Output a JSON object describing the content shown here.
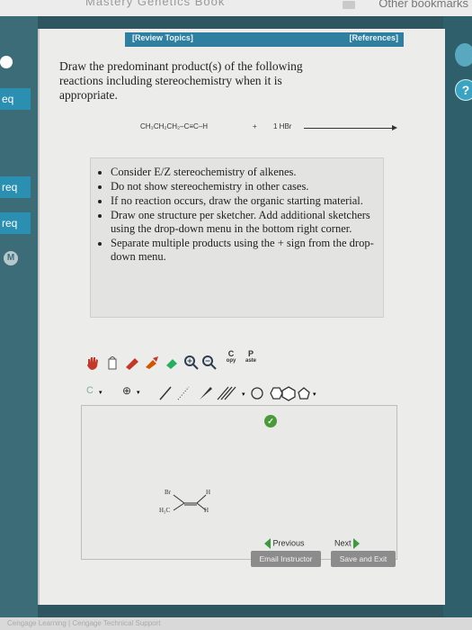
{
  "browser": {
    "ghost_text": "Mastery  Genetics Book",
    "bookmarks_label": "Other bookmarks"
  },
  "sidebar": {
    "items": [
      {
        "label": "eq"
      },
      {
        "label": "req"
      },
      {
        "label": "req"
      }
    ],
    "badge": "M"
  },
  "header": {
    "review_topics": "[Review Topics]",
    "references": "[References]"
  },
  "help_label": "?",
  "question": {
    "prompt": "Draw the predominant product(s) of the following reactions including stereochemistry when it is appropriate."
  },
  "reaction": {
    "reactant": "CH₃CH₂CH₂–C≡C–H",
    "plus": "+",
    "reagent": "1 HBr"
  },
  "instructions": [
    "Consider E/Z stereochemistry of alkenes.",
    "Do not show stereochemistry in other cases.",
    "If no reaction occurs, draw the organic starting material.",
    "Draw one structure per sketcher. Add additional sketchers using the drop-down menu in the bottom right corner.",
    "Separate multiple products using the + sign from the drop-down menu."
  ],
  "sketcher": {
    "copy_top": "C",
    "copy_bottom": "opy",
    "paste_top": "P",
    "paste_bottom": "aste",
    "element_label": "C",
    "charge_label": "⊕",
    "molecule_labels": {
      "br": "Br",
      "h_top": "H",
      "h3c": "H₃C",
      "h_bottom": "H"
    }
  },
  "navigation": {
    "previous": "Previous",
    "next": "Next"
  },
  "buttons": {
    "email": "Email Instructor",
    "save": "Save and Exit"
  },
  "footer_text": "Cengage Learning | Cengage Technical Support",
  "colors": {
    "accent": "#2e7fa0",
    "background": "#2f5560",
    "panel": "#ececea"
  }
}
